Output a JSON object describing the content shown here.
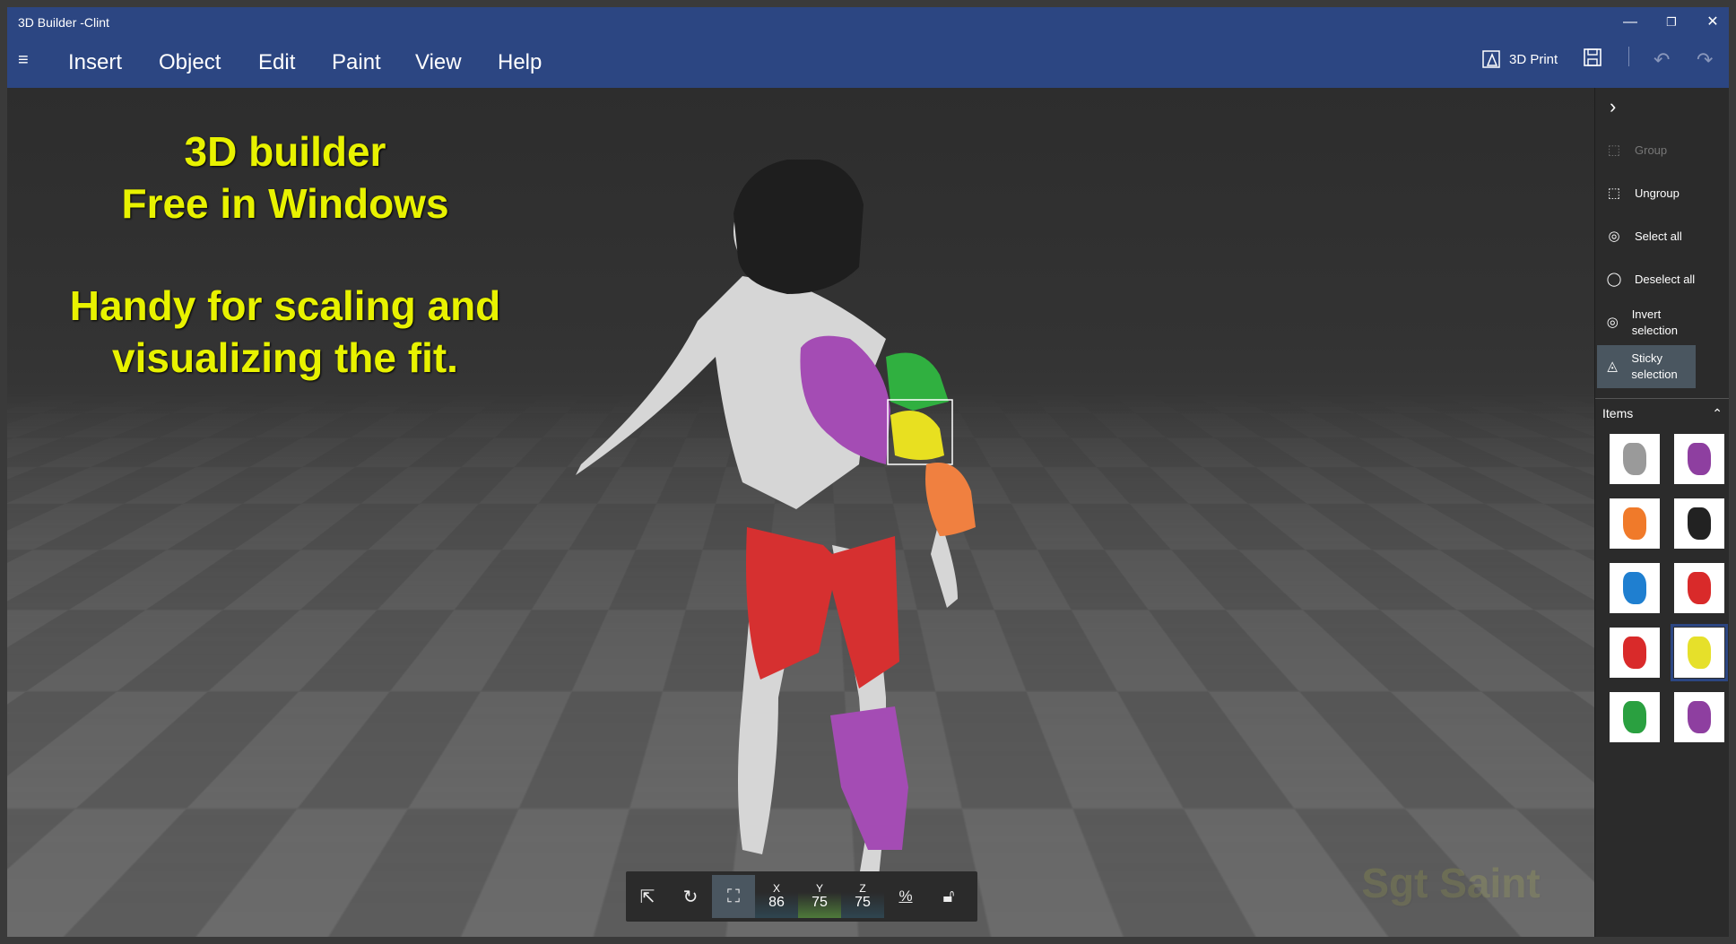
{
  "window": {
    "title": "3D Builder -Clint",
    "minimize": "—",
    "restore": "❐",
    "close": "✕"
  },
  "menu": {
    "hamburger": "≡",
    "items": [
      "Insert",
      "Object",
      "Edit",
      "Paint",
      "View",
      "Help"
    ]
  },
  "toolbar_right": {
    "print_label": "3D Print",
    "save_icon": "save-icon",
    "undo_icon": "undo-icon",
    "redo_icon": "redo-icon"
  },
  "overlay": {
    "line1": "3D builder",
    "line2": "Free in Windows",
    "line3": "Handy for scaling and",
    "line4": "visualizing the fit.",
    "signature": "Sgt Saint"
  },
  "transform": {
    "x_label": "X",
    "x": "86",
    "y_label": "Y",
    "y": "75",
    "z_label": "Z",
    "z": "75",
    "unit": "%"
  },
  "panel": {
    "collapse": "›",
    "actions": [
      {
        "label": "Group",
        "enabled": false
      },
      {
        "label": "Ungroup",
        "enabled": true
      },
      {
        "label": "Select all",
        "enabled": true
      },
      {
        "label": "Deselect all",
        "enabled": true
      },
      {
        "label": "Invert selection",
        "enabled": true
      },
      {
        "label": "Sticky selection",
        "enabled": true,
        "active": true
      }
    ],
    "items_header": "Items",
    "items_toggle": "⌃",
    "items": [
      {
        "name": "body",
        "color": "#9a9a9a"
      },
      {
        "name": "purple-leg",
        "color": "#8e3fa0"
      },
      {
        "name": "orange-forearm",
        "color": "#f07a2a"
      },
      {
        "name": "helmet",
        "color": "#222222"
      },
      {
        "name": "blue-piece",
        "color": "#1f7fd0"
      },
      {
        "name": "red-thigh",
        "color": "#d92a2a"
      },
      {
        "name": "red-thigh-2",
        "color": "#d92a2a"
      },
      {
        "name": "yellow-bicep",
        "color": "#e6e02a",
        "selected": true
      },
      {
        "name": "green-shoulder",
        "color": "#2aa040"
      },
      {
        "name": "purple-chest",
        "color": "#8e3fa0"
      }
    ]
  }
}
